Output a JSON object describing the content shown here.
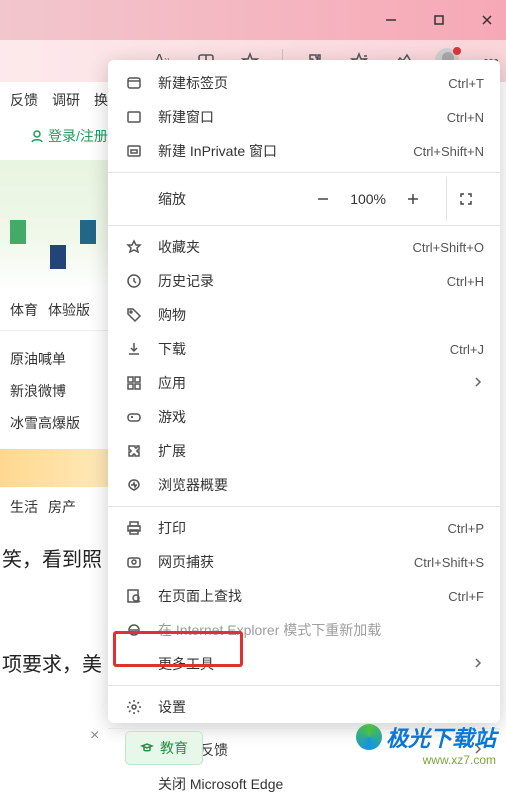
{
  "window": {
    "minimize": "—",
    "maximize": "□",
    "close": "✕"
  },
  "toolbar": {},
  "left": {
    "nav": [
      "反馈",
      "调研",
      "换"
    ],
    "login": "登录/注册",
    "pills": [
      "体育",
      "体验版"
    ],
    "list": [
      "原油喊单",
      "新浪微博",
      "冰雪高爆版"
    ],
    "nav2": [
      "生活",
      "房产"
    ],
    "line1": "笑，看到照",
    "line2": "项要求，美"
  },
  "menu": {
    "newTab": {
      "label": "新建标签页",
      "shortcut": "Ctrl+T"
    },
    "newWindow": {
      "label": "新建窗口",
      "shortcut": "Ctrl+N"
    },
    "newInPrivate": {
      "label": "新建 InPrivate 窗口",
      "shortcut": "Ctrl+Shift+N"
    },
    "zoom": {
      "label": "缩放",
      "value": "100%"
    },
    "favorites": {
      "label": "收藏夹",
      "shortcut": "Ctrl+Shift+O"
    },
    "history": {
      "label": "历史记录",
      "shortcut": "Ctrl+H"
    },
    "shopping": {
      "label": "购物"
    },
    "downloads": {
      "label": "下载",
      "shortcut": "Ctrl+J"
    },
    "apps": {
      "label": "应用"
    },
    "games": {
      "label": "游戏"
    },
    "extensions": {
      "label": "扩展"
    },
    "browserEssentials": {
      "label": "浏览器概要"
    },
    "print": {
      "label": "打印",
      "shortcut": "Ctrl+P"
    },
    "webCapture": {
      "label": "网页捕获",
      "shortcut": "Ctrl+Shift+S"
    },
    "findOnPage": {
      "label": "在页面上查找",
      "shortcut": "Ctrl+F"
    },
    "ieMode": {
      "label": "在 Internet Explorer 模式下重新加载"
    },
    "moreTools": {
      "label": "更多工具"
    },
    "settings": {
      "label": "设置"
    },
    "help": {
      "label": "帮助和反馈"
    },
    "closeEdge": {
      "label": "关闭 Microsoft Edge"
    }
  },
  "eduChip": "教育",
  "watermark": {
    "brand": "极光下载站",
    "url": "www.xz7.com"
  }
}
